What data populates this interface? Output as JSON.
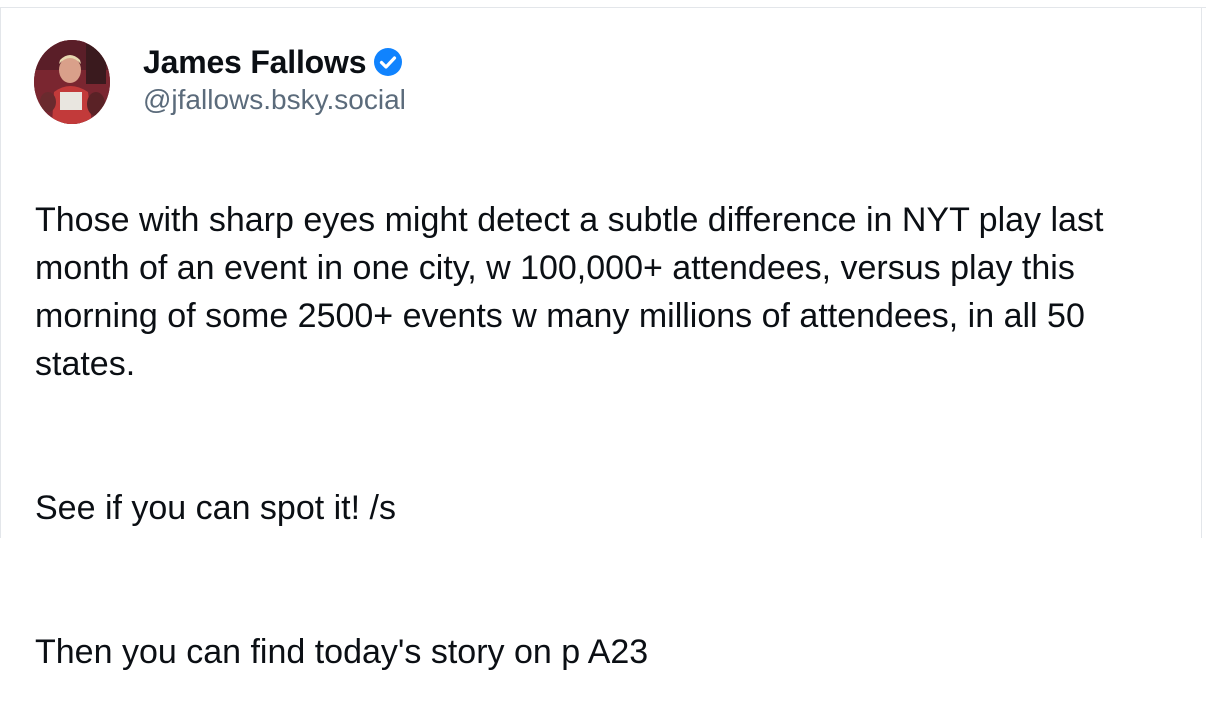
{
  "post": {
    "author": {
      "display_name": "James Fallows",
      "handle": "@jfallows.bsky.social",
      "verified": true,
      "verified_icon": "verified-check-icon",
      "accent_color": "#1083fe"
    },
    "avatar": {
      "icon": "avatar-photo"
    },
    "paragraphs": [
      "Those with sharp eyes might detect a subtle difference in NYT play last month of an event in one city, w 100,000+ attendees, versus play this morning of some 2500+  events w many millions of attendees, in all 50 states.",
      "See if you can spot it! /s",
      "Then you can find today's story on p A23"
    ]
  }
}
